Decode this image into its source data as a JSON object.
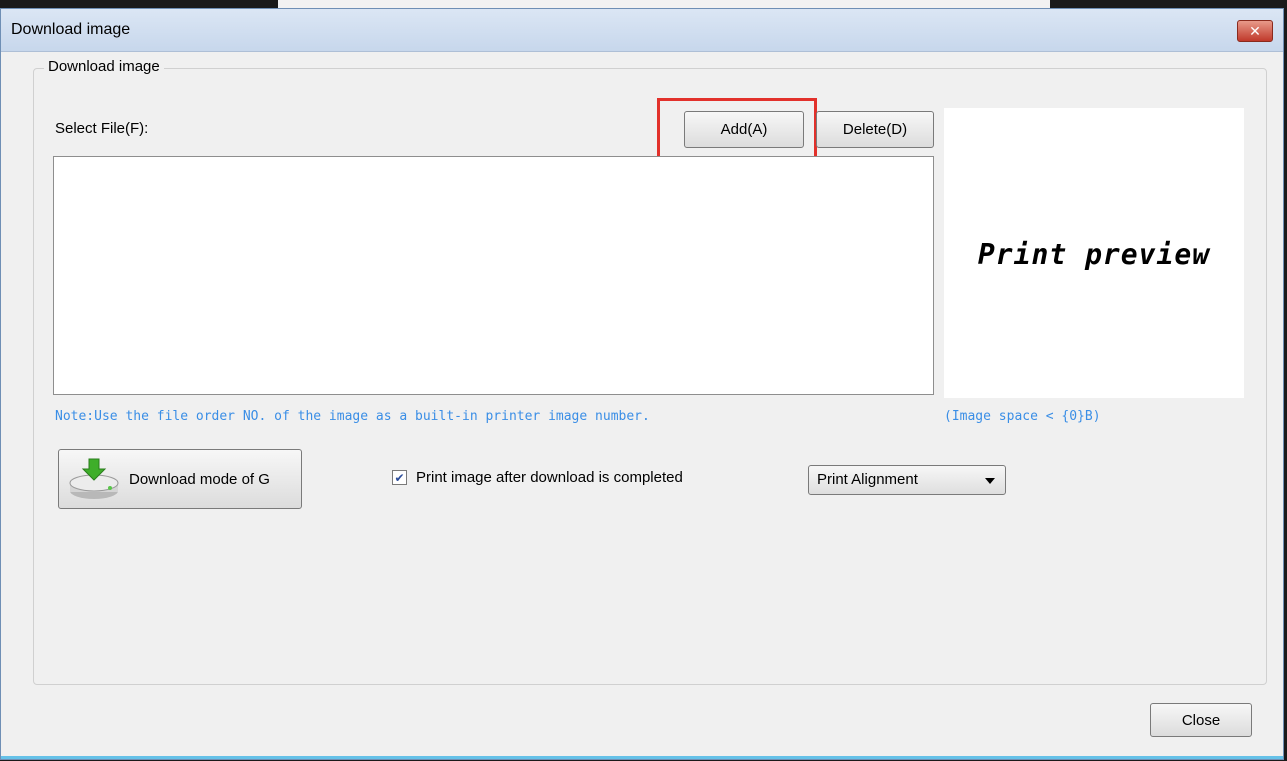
{
  "window": {
    "title": "Download image",
    "close_glyph": "✕"
  },
  "group": {
    "legend": "Download image"
  },
  "file_select": {
    "label": "Select File(F):",
    "add_label": "Add(A)",
    "delete_label": "Delete(D)"
  },
  "preview": {
    "text": "Print preview",
    "image_space": "(Image space < {0}B)"
  },
  "note": "Note:Use the file order NO. of the image as a built-in printer image number.",
  "download": {
    "button_label": "Download mode of G",
    "icon": "download-drive-icon"
  },
  "print_after": {
    "checked": true,
    "label": "Print image after download is completed"
  },
  "alignment": {
    "selected": "Print Alignment"
  },
  "footer": {
    "close_label": "Close"
  },
  "colors": {
    "note_text": "#3a8ee6",
    "highlight": "#e2312b",
    "title_bar": "#dbe6f4"
  }
}
